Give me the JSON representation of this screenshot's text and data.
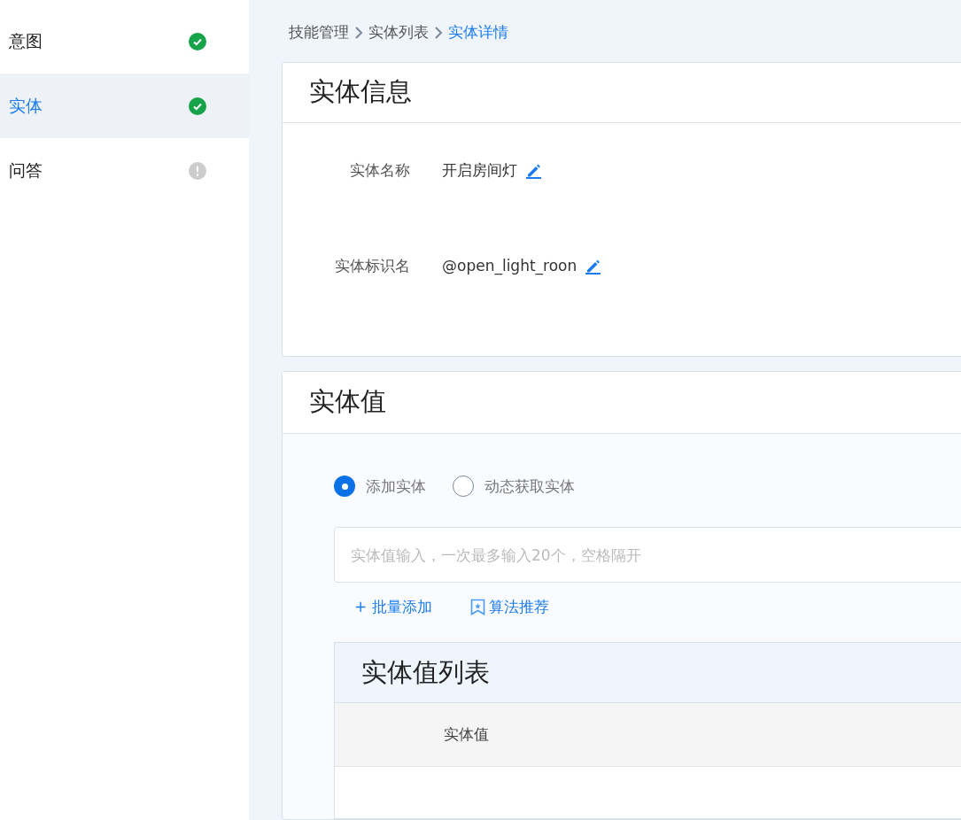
{
  "sidebar": {
    "items": [
      {
        "label": "意图",
        "selected": false,
        "kind": "done"
      },
      {
        "label": "实体",
        "selected": true,
        "kind": "done"
      },
      {
        "label": "问答",
        "selected": false,
        "kind": "warning"
      }
    ]
  },
  "breadcrumb": [
    {
      "label": "技能管理",
      "current": false
    },
    {
      "label": "实体列表",
      "current": false
    },
    {
      "label": "实体详情",
      "current": true
    }
  ],
  "entity_info": {
    "title": "实体信息",
    "fields": [
      {
        "label": "实体名称",
        "value": "开启房间灯"
      },
      {
        "label": "实体标识名",
        "value": "@open_light_roon"
      }
    ]
  },
  "entity_values": {
    "title": "实体值",
    "radios": [
      {
        "label": "添加实体",
        "selected": true
      },
      {
        "label": "动态获取实体",
        "selected": false
      }
    ],
    "input": {
      "placeholder": "实体值输入，一次最多输入20个，空格隔开"
    },
    "actions": [
      {
        "kind": "plus",
        "label": "+ 批量添加"
      },
      {
        "kind": "recommend",
        "label": "算法推荐"
      }
    ],
    "table": {
      "title": "实体值列表",
      "columns": [
        "实体值"
      ]
    }
  }
}
